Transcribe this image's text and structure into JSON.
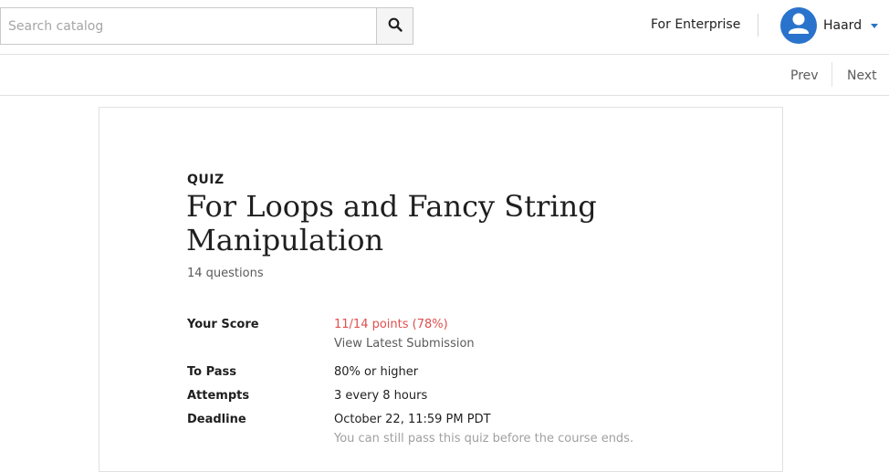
{
  "header": {
    "search": {
      "placeholder": "Search catalog",
      "value": ""
    },
    "enterprise_link": "For Enterprise",
    "user": {
      "name": "Haard"
    },
    "colors": {
      "accent": "#2a73cc"
    }
  },
  "subnav": {
    "prev_label": "Prev",
    "next_label": "Next"
  },
  "quiz": {
    "type_label": "QUIZ",
    "title": "For Loops and Fancy String Manipulation",
    "question_count": "14 questions",
    "score": {
      "label": "Your Score",
      "value": "11/14 points (78%)",
      "link": "View Latest Submission",
      "color": "#e04f4f"
    },
    "to_pass": {
      "label": "To Pass",
      "value": "80% or higher"
    },
    "attempts": {
      "label": "Attempts",
      "value": "3 every 8 hours"
    },
    "deadline": {
      "label": "Deadline",
      "value": "October 22, 11:59 PM PDT",
      "note": "You can still pass this quiz before the course ends."
    }
  }
}
